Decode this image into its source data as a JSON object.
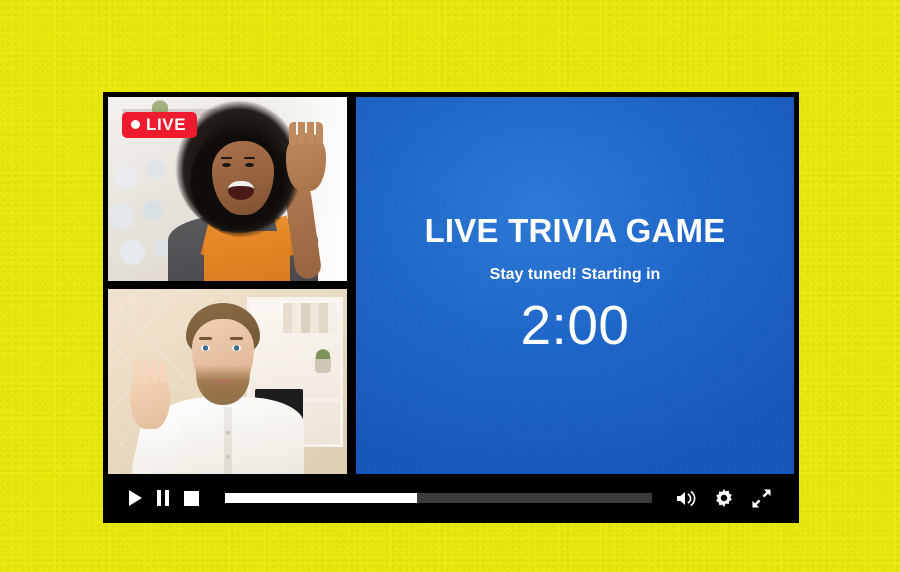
{
  "theme": {
    "background_color": "#e9e90d",
    "player_frame_color": "#000000",
    "stage_blue": "#1f66c9",
    "live_badge_color": "#ee1b2e",
    "text_color": "#ffffff",
    "progress_fill_color": "#ffffff",
    "progress_track_color": "#3b3b3b"
  },
  "player": {
    "participants": [
      {
        "name": "participant-tile-woman",
        "badge": {
          "label": "LIVE",
          "icon": "live-dot-icon"
        },
        "description": "Smiling woman with afro hair in grey t-shirt and orange overalls waving at camera"
      },
      {
        "name": "participant-tile-man",
        "description": "Bearded man in white shirt waving at camera in front of office shelving"
      }
    ],
    "stage": {
      "title": "LIVE TRIVIA GAME",
      "subtitle": "Stay tuned! Starting in",
      "countdown": "2:00"
    },
    "controls": {
      "play_label": "Play",
      "pause_label": "Pause",
      "stop_label": "Stop",
      "play_icon": "play-icon",
      "pause_icon": "pause-icon",
      "stop_icon": "stop-icon",
      "volume_icon": "volume-icon",
      "settings_icon": "gear-icon",
      "fullscreen_icon": "fullscreen-icon",
      "volume_label": "Volume",
      "settings_label": "Settings",
      "fullscreen_label": "Fullscreen",
      "progress_percent": 45
    }
  }
}
